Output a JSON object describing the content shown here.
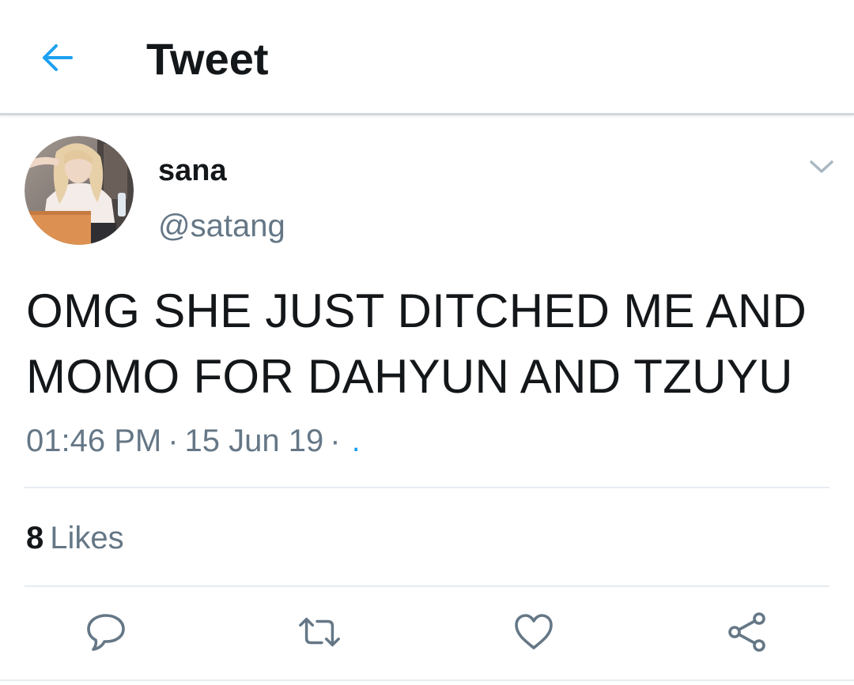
{
  "header": {
    "back_icon": "arrow-left-icon",
    "title": "Tweet"
  },
  "tweet": {
    "author": {
      "display_name": "sana",
      "handle": "@satang",
      "avatar_icon": "profile-photo"
    },
    "menu_icon": "chevron-down-icon",
    "text": "OMG SHE JUST DITCHED ME AND MOMO FOR DAHYUN AND TZUYU",
    "time": "01:46 PM",
    "separator": "·",
    "date": "15 Jun 19",
    "source": ".",
    "likes": {
      "count": "8",
      "label": "Likes"
    },
    "actions": [
      {
        "name": "reply",
        "icon": "speech-bubble-icon"
      },
      {
        "name": "retweet",
        "icon": "retweet-arrows-icon"
      },
      {
        "name": "like",
        "icon": "heart-icon"
      },
      {
        "name": "share",
        "icon": "share-nodes-icon"
      }
    ]
  },
  "colors": {
    "accent": "#1da1f2",
    "text_primary": "#14171a",
    "text_secondary": "#657786",
    "divider": "#e6ecf0"
  }
}
